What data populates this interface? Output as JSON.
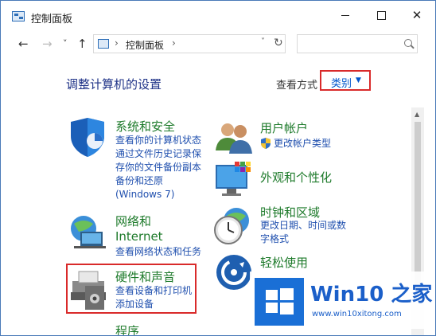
{
  "window": {
    "title": "控制面板",
    "minimize_label": "minimize",
    "maximize_label": "maximize",
    "close_label": "✕"
  },
  "navbar": {
    "back": "←",
    "forward": "→",
    "history": "˅",
    "up": "↑",
    "address": "控制面板",
    "address_sep": "›",
    "address_sep2": "›",
    "address_dropdown": "˅",
    "refresh": "↻",
    "search_placeholder": ""
  },
  "header": {
    "heading": "调整计算机的设置",
    "view_by_label": "查看方式",
    "view_by_value": "类别",
    "view_by_caret": "▼"
  },
  "categories": {
    "system": {
      "title": "系统和安全",
      "links": [
        "查看你的计算机状态",
        "通过文件历史记录保",
        "存你的文件备份副本",
        "备份和还原",
        "(Windows 7)"
      ]
    },
    "network": {
      "title_line1": "网络和",
      "title_line2": "Internet",
      "links": [
        "查看网络状态和任务"
      ]
    },
    "hardware": {
      "title": "硬件和声音",
      "links": [
        "查看设备和打印机",
        "添加设备"
      ]
    },
    "programs": {
      "title": "程序"
    },
    "accounts": {
      "title": "用户帐户",
      "links": [
        "更改帐户类型"
      ]
    },
    "appearance": {
      "title": "外观和个性化"
    },
    "clock": {
      "title": "时钟和区域",
      "links": [
        "更改日期、时间或数",
        "字格式"
      ]
    },
    "ease": {
      "title": "轻松使用"
    }
  },
  "watermark": {
    "brand": "Win10 之家",
    "url": "www.win10xitong.com"
  },
  "colors": {
    "accent_red": "#d92a2a",
    "category_green": "#1d7a2a",
    "link_blue": "#1f4fae",
    "heading_blue": "#1e3287",
    "watermark_blue": "#1a6fd6"
  }
}
